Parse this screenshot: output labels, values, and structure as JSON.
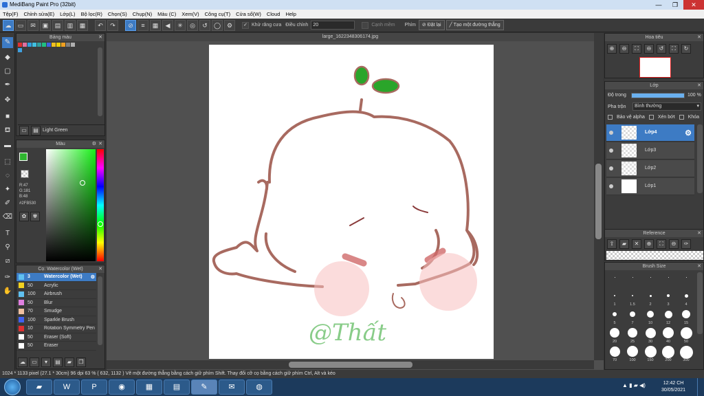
{
  "window": {
    "title": "MediBang Paint Pro (32bit)",
    "min": "—",
    "max": "❐",
    "close": "✕"
  },
  "menu": [
    "Tệp(F)",
    "Chỉnh sửa(E)",
    "Lớp(L)",
    "Bộ lọc(R)",
    "Chọn(S)",
    "Chụp(N)",
    "Màu (C)",
    "Xem(V)",
    "Công cụ(T)",
    "Cửa sổ(W)",
    "Cloud",
    "Help"
  ],
  "toolbar": {
    "antialias_label": "Khử răng cưa",
    "correction_label": "Điều chỉnh",
    "correction_value": "20",
    "canh_mem_label": "Cạnh mềm",
    "phim_label": "Phím",
    "reset_label": "Đặt lại",
    "create_line_label": "Tạo một đường thẳng"
  },
  "palette": {
    "title": "Bảng màu",
    "selected_name": "Light Green",
    "swatches": [
      "#e03030",
      "#e070a0",
      "#30a0e0",
      "#40c0e0",
      "#30a0a0",
      "#20c080",
      "#4060e0",
      "#f0c020",
      "#f0d000",
      "#f0a020",
      "#808080",
      "#b0b0b0",
      "#40a0e0"
    ]
  },
  "color": {
    "title": "Màu",
    "primary": "#2FB530",
    "r_label": "R:47",
    "g_label": "G:181",
    "b_label": "B:48",
    "hex_label": "#2FB530"
  },
  "brush": {
    "title": "Cọ: Watercolor (Wet)",
    "items": [
      {
        "size": "3",
        "name": "Watercolor (Wet)",
        "color": "#60c0f0",
        "selected": true
      },
      {
        "size": "50",
        "name": "Acrylic",
        "color": "#f0d020",
        "selected": false
      },
      {
        "size": "100",
        "name": "Airbrush",
        "color": "#60c0f0",
        "selected": false
      },
      {
        "size": "50",
        "name": "Blur",
        "color": "#e080e0",
        "selected": false
      },
      {
        "size": "70",
        "name": "Smudge",
        "color": "#f0c0a0",
        "selected": false
      },
      {
        "size": "100",
        "name": "Sparkle Brush",
        "color": "#4060f0",
        "selected": false
      },
      {
        "size": "10",
        "name": "Rotation Symmetry Pen",
        "color": "#e03030",
        "selected": false
      },
      {
        "size": "50",
        "name": "Eraser (Soft)",
        "color": "#ffffff",
        "selected": false
      },
      {
        "size": "50",
        "name": "Eraser",
        "color": "#ffffff",
        "selected": false
      }
    ]
  },
  "canvas": {
    "tab_title": "large_1622348306174.jpg",
    "signature": "@Thất"
  },
  "navigator": {
    "title": "Hoa tiêu"
  },
  "layers": {
    "title": "Lớp",
    "opacity_label": "Độ trong",
    "opacity_value": "100 %",
    "blend_label": "Pha trộn",
    "blend_value": "Bình thường",
    "protect_alpha": "Bảo vệ alpha",
    "clipping": "Xén bớt",
    "lock": "Khóa",
    "items": [
      {
        "name": "Lớp4",
        "selected": true
      },
      {
        "name": "Lớp3",
        "selected": false
      },
      {
        "name": "Lớp2",
        "selected": false
      },
      {
        "name": "Lớp1",
        "selected": false
      }
    ]
  },
  "reference": {
    "title": "Reference"
  },
  "brush_size": {
    "title": "Brush Size",
    "sizes": [
      "",
      "",
      "",
      "",
      "",
      "1",
      "1.5",
      "2",
      "3",
      "4",
      "5",
      "7",
      "10",
      "12",
      "15",
      "20",
      "25",
      "30",
      "40",
      "50",
      "70",
      "100",
      "150",
      "200",
      "300"
    ]
  },
  "status": {
    "text": "1024 * 1133 pixel  (27.1 * 30cm)  96 dpi  63 %  ( 632, 1132 )  Vẽ một đường thẳng bằng cách giữ phím Shift. Thay đổi cỡ cọ bằng cách giữ phím Ctrl, Alt và kéo"
  },
  "taskbar": {
    "time": "12:42 CH",
    "date": "30/05/2021"
  }
}
